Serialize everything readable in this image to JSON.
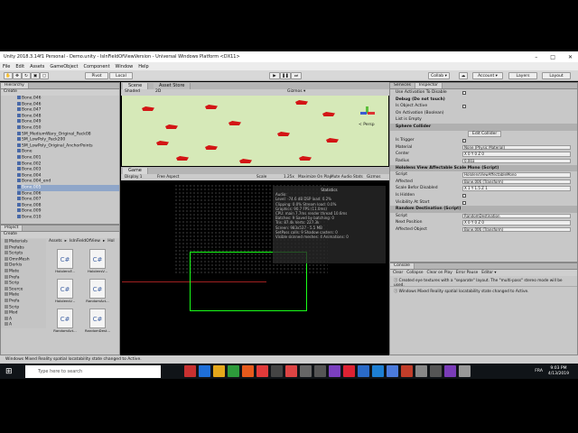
{
  "window": {
    "title": "Unity 2018.3.14f1 Personal - Demo.unity - IsInFieldOfViewVersion - Universal Windows Platform <DX11>"
  },
  "menu": [
    "File",
    "Edit",
    "Assets",
    "GameObject",
    "Component",
    "Window",
    "Help"
  ],
  "toolbar": {
    "pivot": "Pivot",
    "local": "Local",
    "collab": "Collab ▾",
    "account": "Account ▾",
    "layers": "Layers",
    "layout": "Layout"
  },
  "hierarchy": {
    "tab": "Hierarchy",
    "create": "Create",
    "items": [
      "Bone.046",
      "Bone.046",
      "Bone.047",
      "Bone.048",
      "Bone.049",
      "Bone.050",
      "SM_MediumWary_Original_Pack08",
      "SM_LowPoly_Pack200",
      "SM_LowPoly_Original_AnchorPoints",
      "Bone",
      "Bone.001",
      "Bone.002",
      "Bone.003",
      "Bone.004",
      "Bone.004_end",
      "Bone.005",
      "Bone.006",
      "Bone.007",
      "Bone.008",
      "Bone.009",
      "Bone.010"
    ],
    "selected_index": 15
  },
  "scene": {
    "tab_scene": "Scene",
    "tab_asset": "Asset Store",
    "shaded": "Shaded",
    "twod": "2D",
    "gizmos": "Gizmos ▾",
    "persp": "< Persp"
  },
  "game": {
    "tab": "Game",
    "display": "Display 1",
    "aspect": "Free Aspect",
    "scale_label": "Scale",
    "scale": "1.25x",
    "maximize": "Maximize On Play",
    "mute": "Mute Audio",
    "stats": "Stats",
    "gizmos": "Gizmos"
  },
  "stats": {
    "title": "Statistics",
    "lines": [
      "Audio:",
      "  Level: -74.6 dB        DSP load: 0.2%",
      "  Clipping: 0.0%          Stream load: 0.0%",
      "Graphics:                   90.7 FPS (11.0ms)",
      "  CPU: main 7.7ms  render thread 10.6ms",
      "  Batches: 9            Saved by batching: 0",
      "  Tris: 87.4k           Verts: 227.3k",
      "  Screen: 983x537 - 5.5 MB",
      "  SetPass calls: 9      Shadow casters: 0",
      "  Visible skinned meshes: 4   Animations: 0"
    ]
  },
  "project": {
    "tab": "Project",
    "create": "Create",
    "breadcrumb": [
      "Assets",
      "IsInFieldOfView",
      "Hol"
    ],
    "folders": [
      "Materials",
      "Prefabs",
      "Scripts",
      "OmnMesh",
      "Derkis",
      "Mate",
      "Prefa",
      "Scrip",
      "Source",
      "Mate",
      "Prefa",
      "Scrip",
      "Mod",
      "A",
      "A"
    ],
    "files": [
      "HololensF...",
      "HololensV...",
      "HololensV...",
      "RandomAct...",
      "RandomAct...",
      "RandomDest..."
    ]
  },
  "inspector": {
    "tab_inspector": "Inspector",
    "tab_services": "Services",
    "tab_debug": "Debug (Do not touch)",
    "rows": [
      {
        "label": "Use Activation To Disable",
        "type": "check"
      },
      {
        "label": "Debug (Do not touch)",
        "type": "bold"
      },
      {
        "label": "Is Object Active",
        "type": "check"
      },
      {
        "label": "On Activation (Boolean)",
        "type": "text"
      },
      {
        "label": "List is Empty",
        "type": "text"
      },
      {
        "label": "Sphere Collider",
        "type": "sect"
      },
      {
        "label": "Edit Collider",
        "type": "button"
      },
      {
        "label": "Is Trigger",
        "type": "check"
      },
      {
        "label": "Material",
        "type": "field",
        "value": "None (Physic Material)"
      },
      {
        "label": "Center",
        "type": "field",
        "value": "X 0    Y 0    Z 0"
      },
      {
        "label": "Radius",
        "type": "field",
        "value": "0.003"
      },
      {
        "label": "Hololens View Affectable Scale Mono (Script)",
        "type": "sect"
      },
      {
        "label": "Script",
        "type": "field",
        "value": "HololensViewAffectableMono"
      },
      {
        "label": "Affected",
        "type": "field",
        "value": "Bone.006 (Transform)"
      },
      {
        "label": "Scale Befor Disabled",
        "type": "field",
        "value": "X 1    Y 1.5    Z 1"
      },
      {
        "label": "Is Hidden",
        "type": "check"
      },
      {
        "label": "Visibility At Start",
        "type": "check"
      },
      {
        "label": "Random Destination (Script)",
        "type": "sect"
      },
      {
        "label": "Script",
        "type": "field",
        "value": "RandomDestination"
      },
      {
        "label": "Next Position",
        "type": "field",
        "value": "X 0    Y 0    Z 0"
      },
      {
        "label": "Affected Object",
        "type": "field",
        "value": "Bone.006 (Transform)"
      }
    ]
  },
  "console": {
    "tab": "Console",
    "clear": "Clear",
    "collapse": "Collapse",
    "clear_on_play": "Clear on Play",
    "error_pause": "Error Pause",
    "editor": "Editor ▾",
    "messages": [
      "Created eye textures with a \"separate\" layout.  The \"multi-pass\" stereo mode will be used.",
      "Windows Mixed Reality spatial locatability state changed to Active."
    ]
  },
  "status": {
    "text": "Windows Mixed Reality spatial locatability state changed to Active."
  },
  "taskbar": {
    "search": "Type here to search",
    "lang": "FRA",
    "time": "9:03 PM",
    "date": "4/13/2019"
  }
}
